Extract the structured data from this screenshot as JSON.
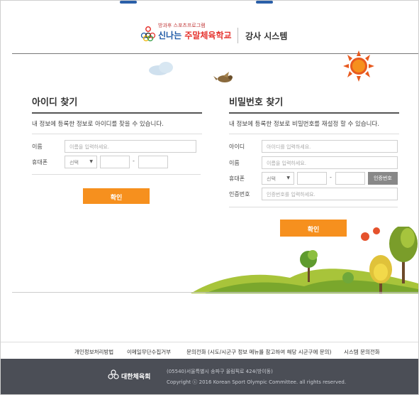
{
  "header": {
    "logo_sub": "방과후 스포츠프로그램",
    "logo_main_a": "신나는 ",
    "logo_main_b": "주말체육학교",
    "system_title": "강사 시스템"
  },
  "find_id": {
    "title": "아이디 찾기",
    "description": "내 정보에 등록한 정보로 아이디를 찾을 수 있습니다.",
    "name_label": "이름",
    "name_placeholder": "이름을 입력하세요.",
    "phone_label": "휴대폰",
    "phone_select": "선택",
    "confirm_label": "확인"
  },
  "find_pw": {
    "title": "비밀번호 찾기",
    "description": "내 정보에 등록한 정보로 비밀번호를 재설정 할 수 있습니다.",
    "id_label": "아이디",
    "id_placeholder": "아이디를 입력하세요.",
    "name_label": "이름",
    "name_placeholder": "이름을 입력하세요.",
    "phone_label": "휴대폰",
    "phone_select": "선택",
    "verify_button": "인증번호",
    "code_label": "인증번호",
    "code_placeholder": "인증번호를 입력하세요.",
    "confirm_label": "확인"
  },
  "dash": "-",
  "footer": {
    "links": [
      "개인정보처리방법",
      "이메일무단수집거부",
      "문의전화 (시도/시군구 정보 메뉴를 참고하여 해당 시군구에 문의)",
      "시스템 문의전화"
    ],
    "org_name": "대한체육회",
    "address": "(05540)서울특별시 송파구 올림픽로 424(방이동)",
    "copyright": "Copyright ⓒ 2016 Korean Sport Olympic Committee. all rights reserved."
  },
  "colors": {
    "accent_orange": "#f6901e",
    "brand_blue": "#1f5aa6",
    "brand_red": "#e5322d",
    "footer_bg": "#4b4e56",
    "verify_gray": "#888888"
  }
}
